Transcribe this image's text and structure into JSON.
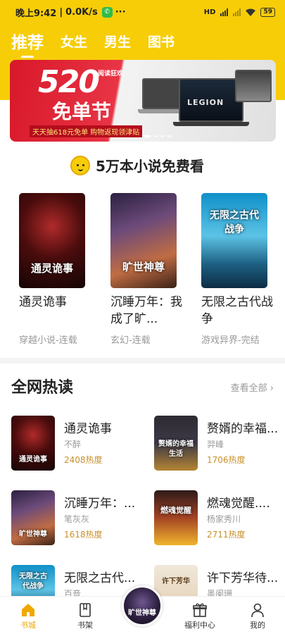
{
  "status_bar": {
    "time": "晚上9:42",
    "speed": "0.0K/s",
    "more": "···",
    "network": "HD",
    "battery": "59"
  },
  "top_tabs": [
    {
      "label": "推荐",
      "active": true
    },
    {
      "label": "女生",
      "active": false
    },
    {
      "label": "男生",
      "active": false
    },
    {
      "label": "图书",
      "active": false
    }
  ],
  "banner": {
    "headline": "520",
    "headline_tag": "阅读狂欢",
    "title": "免单节",
    "subtitle": "天天抽618元免单 购物返现领津贴",
    "brand": "LEGION",
    "page_count": 4,
    "current_page": 1
  },
  "free_section": {
    "title": "5万本小说免费看",
    "books": [
      {
        "title": "通灵诡事",
        "meta": "穿越小说-连载",
        "cover_text": "通灵诡事"
      },
      {
        "title": "沉睡万年：我成了旷...",
        "meta": "玄幻-连载",
        "cover_text": "旷世神尊"
      },
      {
        "title": "无限之古代战争",
        "meta": "游戏异界-完结",
        "cover_text": "无限之古代战争"
      }
    ]
  },
  "hot_section": {
    "title": "全网热读",
    "view_all": "查看全部",
    "items": [
      {
        "title": "通灵诡事",
        "author": "不醉",
        "heat": "2408热度",
        "cover_text": "通灵诡事"
      },
      {
        "title": "赘婿的幸福...",
        "author": "羿峰",
        "heat": "1706热度",
        "cover_text": "赘婿的幸福生活"
      },
      {
        "title": "沉睡万年：...",
        "author": "笔灰灰",
        "heat": "1618热度",
        "cover_text": "旷世神尊"
      },
      {
        "title": "燃魂觉醒....",
        "author": "杨家秀川",
        "heat": "2711热度",
        "cover_text": "燃魂觉醒"
      },
      {
        "title": "无限之古代...",
        "author": "百音",
        "heat": "",
        "cover_text": "无限之古代战争"
      },
      {
        "title": "许下芳华待...",
        "author": "墨阑珊",
        "heat": "",
        "cover_text": "许下芳华"
      }
    ]
  },
  "bottom_nav": [
    {
      "label": "书城",
      "icon": "home-icon",
      "active": true
    },
    {
      "label": "书架",
      "icon": "bookshelf-icon",
      "active": false
    },
    {
      "label": "福利中心",
      "icon": "gift-icon",
      "active": false
    },
    {
      "label": "我的",
      "icon": "profile-icon",
      "active": false
    }
  ],
  "center_book": {
    "cover_text": "旷世神尊"
  },
  "colors": {
    "brand_yellow": "#f7cd08",
    "heat_text": "#c8902b",
    "active_nav": "#f0a800"
  }
}
